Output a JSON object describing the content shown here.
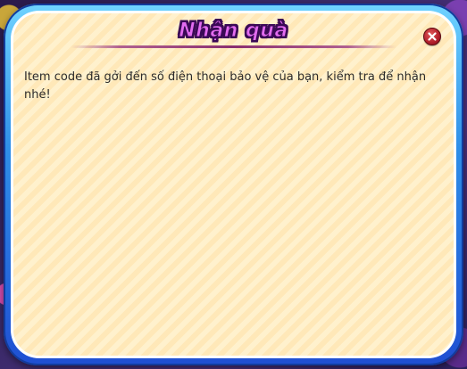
{
  "dialog": {
    "title": "Nhận quà",
    "message": "Item code đã gởi đến số điện thoại bảo vệ của bạn, kiểm tra để nhận nhé!",
    "close_icon": "close-icon"
  },
  "colors": {
    "title_fill": "#e36cf0",
    "title_outline": "#3b0a56",
    "frame_blue": "#2f8fe8",
    "panel_bg": "#ffe8b8",
    "close_red": "#b21e2a",
    "text": "#2b2b2b"
  }
}
